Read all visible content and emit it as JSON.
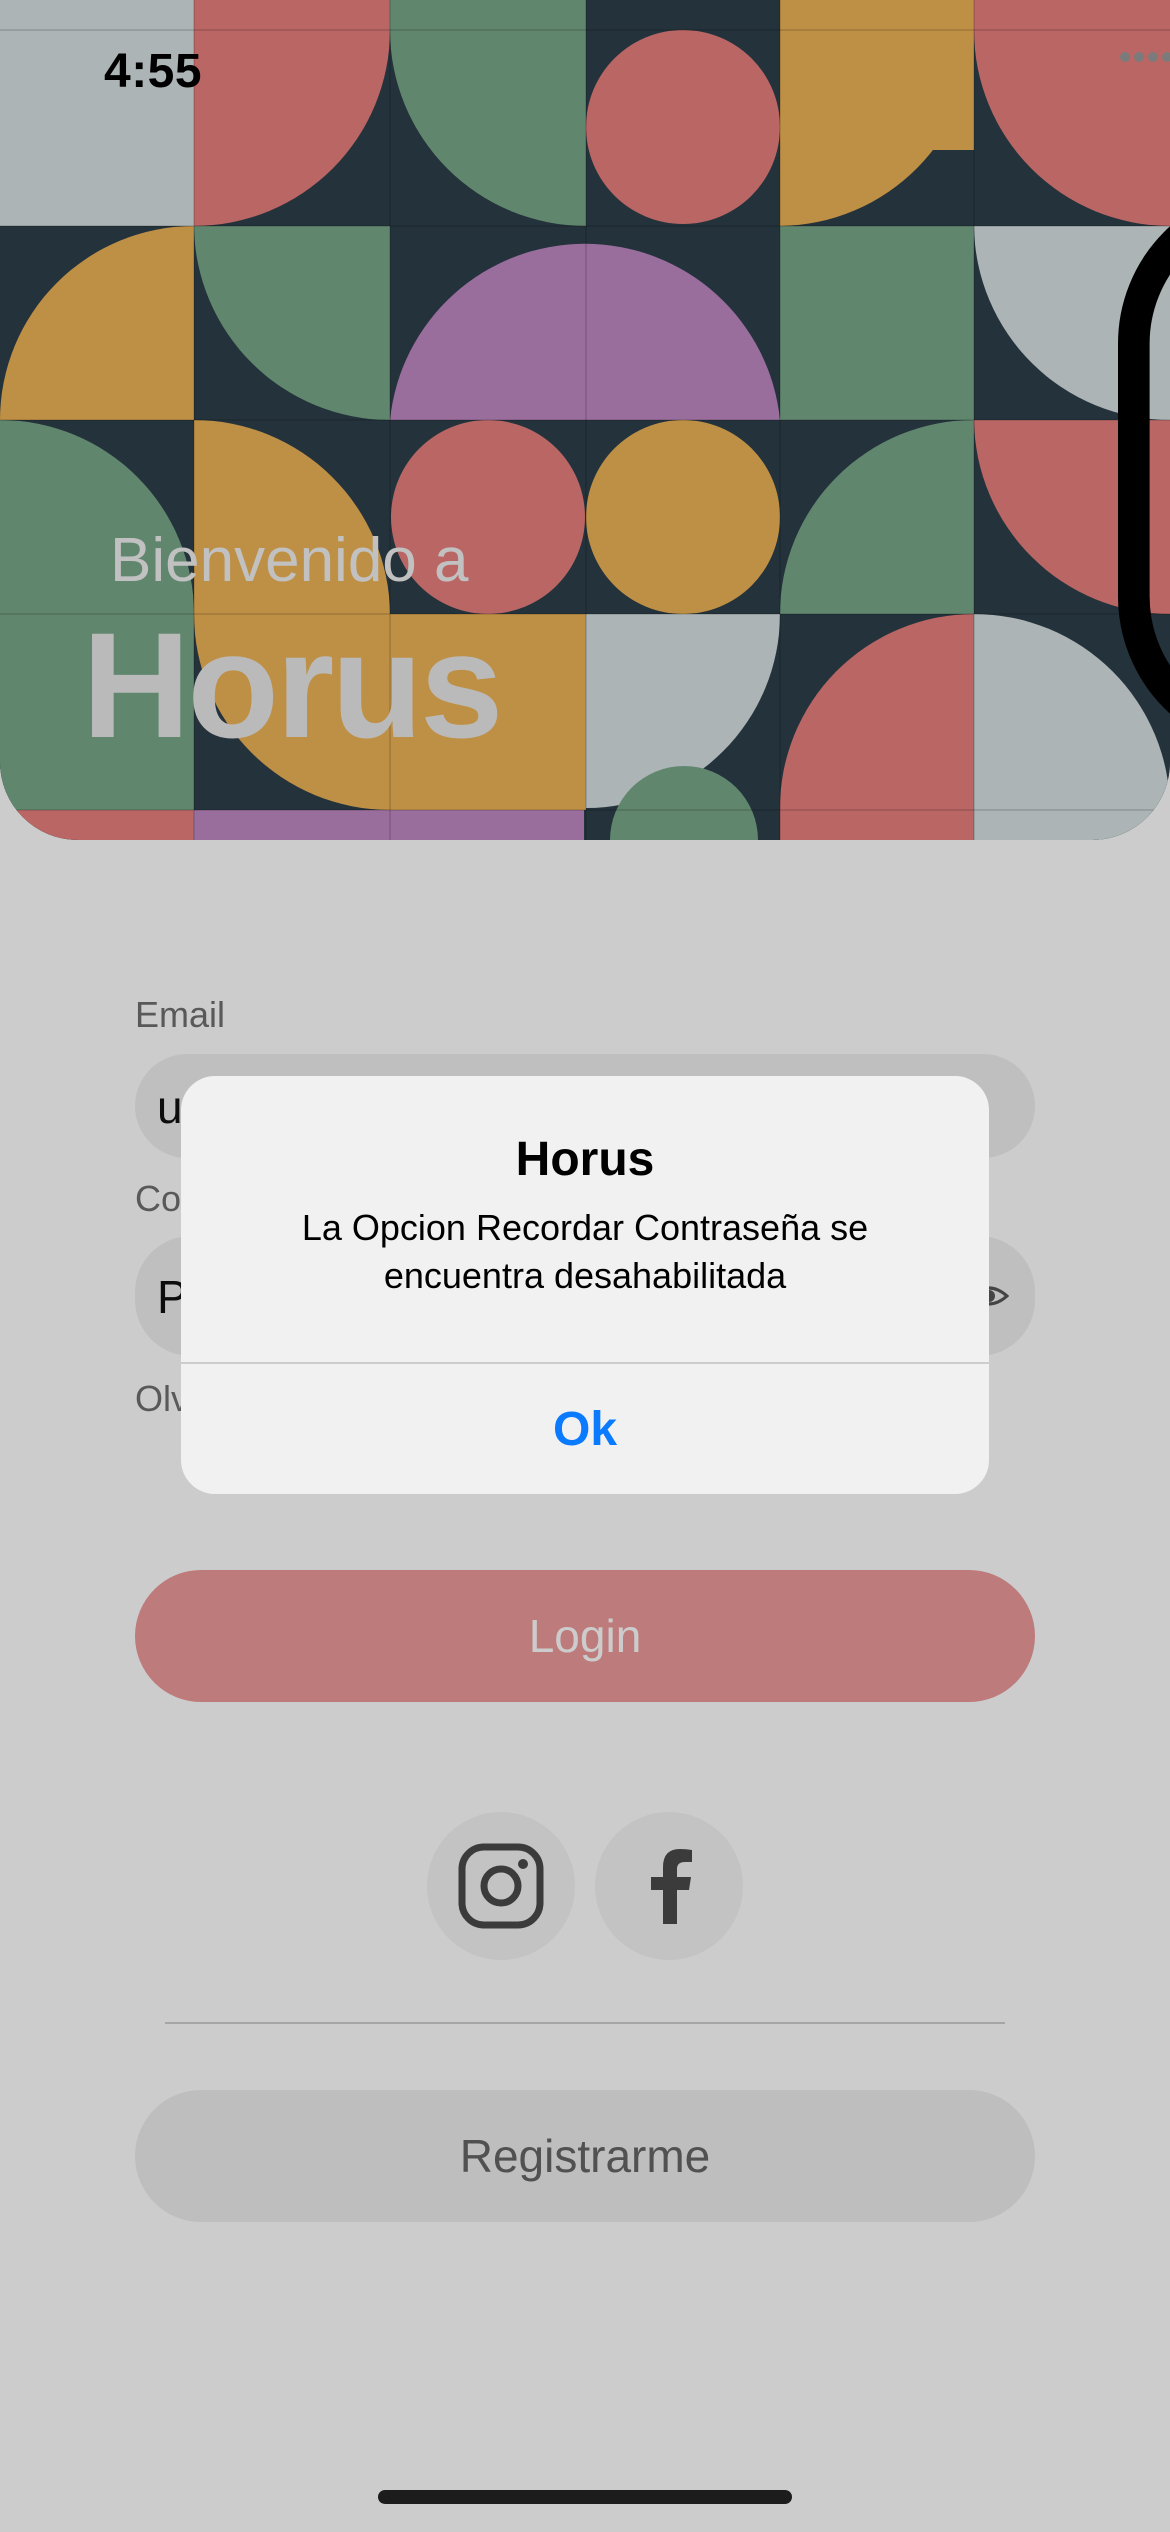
{
  "status_bar": {
    "time": "4:55"
  },
  "hero": {
    "welcome": "Bienvenido a",
    "brand": "Horus"
  },
  "form": {
    "email_label": "Email",
    "email_value": "u",
    "password_label": "Co",
    "password_value": "P",
    "forgot_label": "Olv"
  },
  "buttons": {
    "login": "Login",
    "register": "Registrarme"
  },
  "social": [
    "instagram-icon",
    "facebook-icon"
  ],
  "alert": {
    "title": "Horus",
    "message": "La Opcion Recordar Contraseña se encuentra desahabilitada",
    "ok_label": "Ok"
  },
  "colors": {
    "accent": "#ee9a9a",
    "alert_button": "#0a7aff",
    "pattern_dark": "#2d3f4b",
    "pattern_green": "#79a98a",
    "pattern_coral": "#e8807e",
    "pattern_mustard": "#eeb457",
    "pattern_lilac": "#c18ac4",
    "pattern_grey": "#d8e2e3"
  }
}
